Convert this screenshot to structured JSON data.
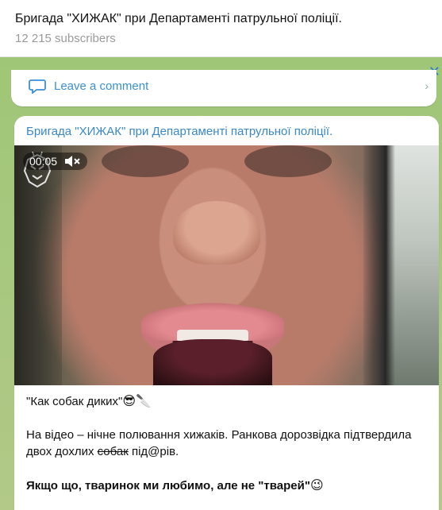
{
  "header": {
    "title": "Бригада \"ХИЖАК\" при Департаменті патрульної поліції.",
    "subscribers": "12 215 subscribers"
  },
  "prev_message": {
    "comment_label": "Leave a comment"
  },
  "message": {
    "author": "Бригада \"ХИЖАК\" при Департаменті патрульної поліції.",
    "video": {
      "duration": "00:05",
      "muted": true
    },
    "caption": {
      "line1": "\"Как собак диких\"",
      "line1_emojis": "😎🔪",
      "line2_part1": "На відео – нічне полювання хижаків. Ранкова дорозвідка підтвердила двох дохлих ",
      "line2_strike": "собак",
      "line2_part2": " під@рів.",
      "line3": "Якщо що, тваринок ми любимо, але не \"тварей\"",
      "line3_emoji": "😉"
    }
  },
  "colors": {
    "link_blue": "#3a88c8",
    "wallpaper_green": "#a9c97e"
  },
  "icons": {
    "close": "close-icon",
    "mute": "speaker-muted-icon",
    "comment": "comment-icon",
    "chevron": "chevron-right-icon",
    "logo": "predator-logo-icon"
  }
}
